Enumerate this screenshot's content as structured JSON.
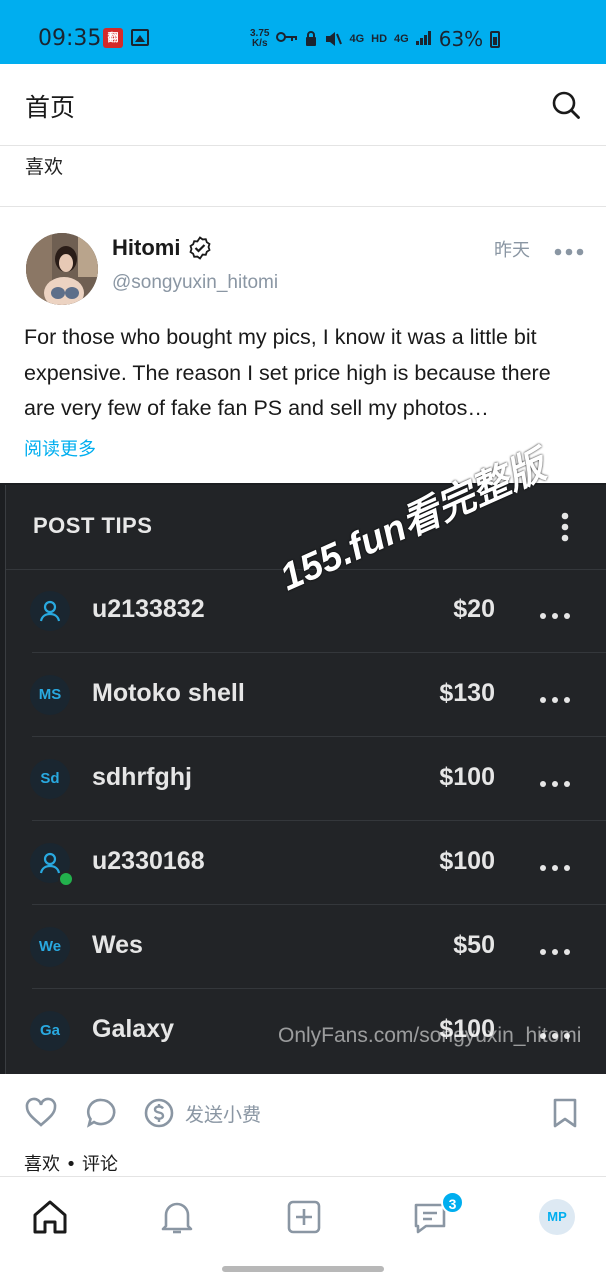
{
  "status_bar": {
    "time": "09:35",
    "app_icon_text": "翻",
    "net_speed_top": "3.75",
    "net_speed_bottom": "K/s",
    "signal_1": "4G",
    "hd": "HD",
    "signal_2": "4G",
    "battery": "63%"
  },
  "header": {
    "title": "首页"
  },
  "likes_label": "喜欢",
  "post": {
    "author": "Hitomi",
    "handle": "@songyuxin_hitomi",
    "time": "昨天",
    "text": "For those who bought my pics, I know it was a little bit expensive. The reason I set price high is because there are very few of fake fan PS and sell my photos…",
    "read_more": "阅读更多"
  },
  "tips_screenshot": {
    "title": "POST TIPS",
    "rows": [
      {
        "avatar": "",
        "name": "u2133832",
        "amount": "$20",
        "online": false
      },
      {
        "avatar": "MS",
        "name": "Motoko shell",
        "amount": "$130",
        "online": false
      },
      {
        "avatar": "Sd",
        "name": "sdhrfghj",
        "amount": "$100",
        "online": false
      },
      {
        "avatar": "",
        "name": "u2330168",
        "amount": "$100",
        "online": true
      },
      {
        "avatar": "We",
        "name": "Wes",
        "amount": "$50",
        "online": false
      },
      {
        "avatar": "Ga",
        "name": "Galaxy",
        "amount": "$100",
        "online": false
      }
    ],
    "watermark": "155.fun看完整版",
    "source_watermark": "OnlyFans.com/songyuxin_hitomi"
  },
  "actions": {
    "send_tip": "发送小费",
    "summary": "喜欢 • 评论"
  },
  "nav": {
    "messages_badge": "3",
    "avatar_initials": "MP"
  },
  "colors": {
    "accent": "#00aeef",
    "muted": "#8a96a3",
    "dark_panel": "#222427",
    "online": "#22b14c"
  }
}
